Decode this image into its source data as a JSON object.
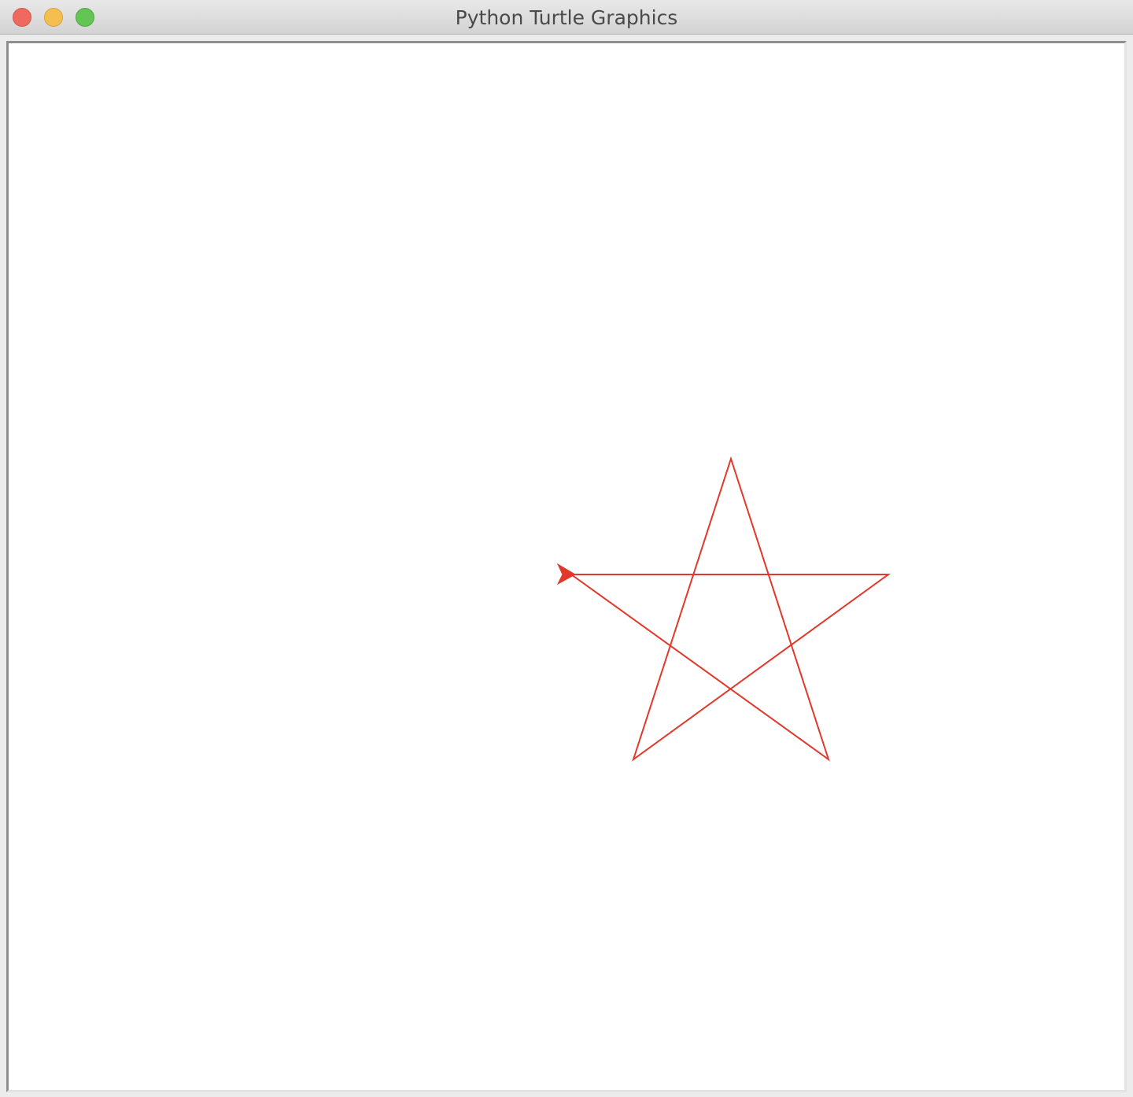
{
  "window": {
    "title": "Python Turtle Graphics"
  },
  "canvas": {
    "background": "#ffffff",
    "drawing": {
      "shape": "five-pointed-star",
      "pen_color": "#e0382b",
      "turtle_heading": "east"
    }
  },
  "controls": {
    "close": "close-icon",
    "minimize": "minimize-icon",
    "maximize": "maximize-icon"
  }
}
